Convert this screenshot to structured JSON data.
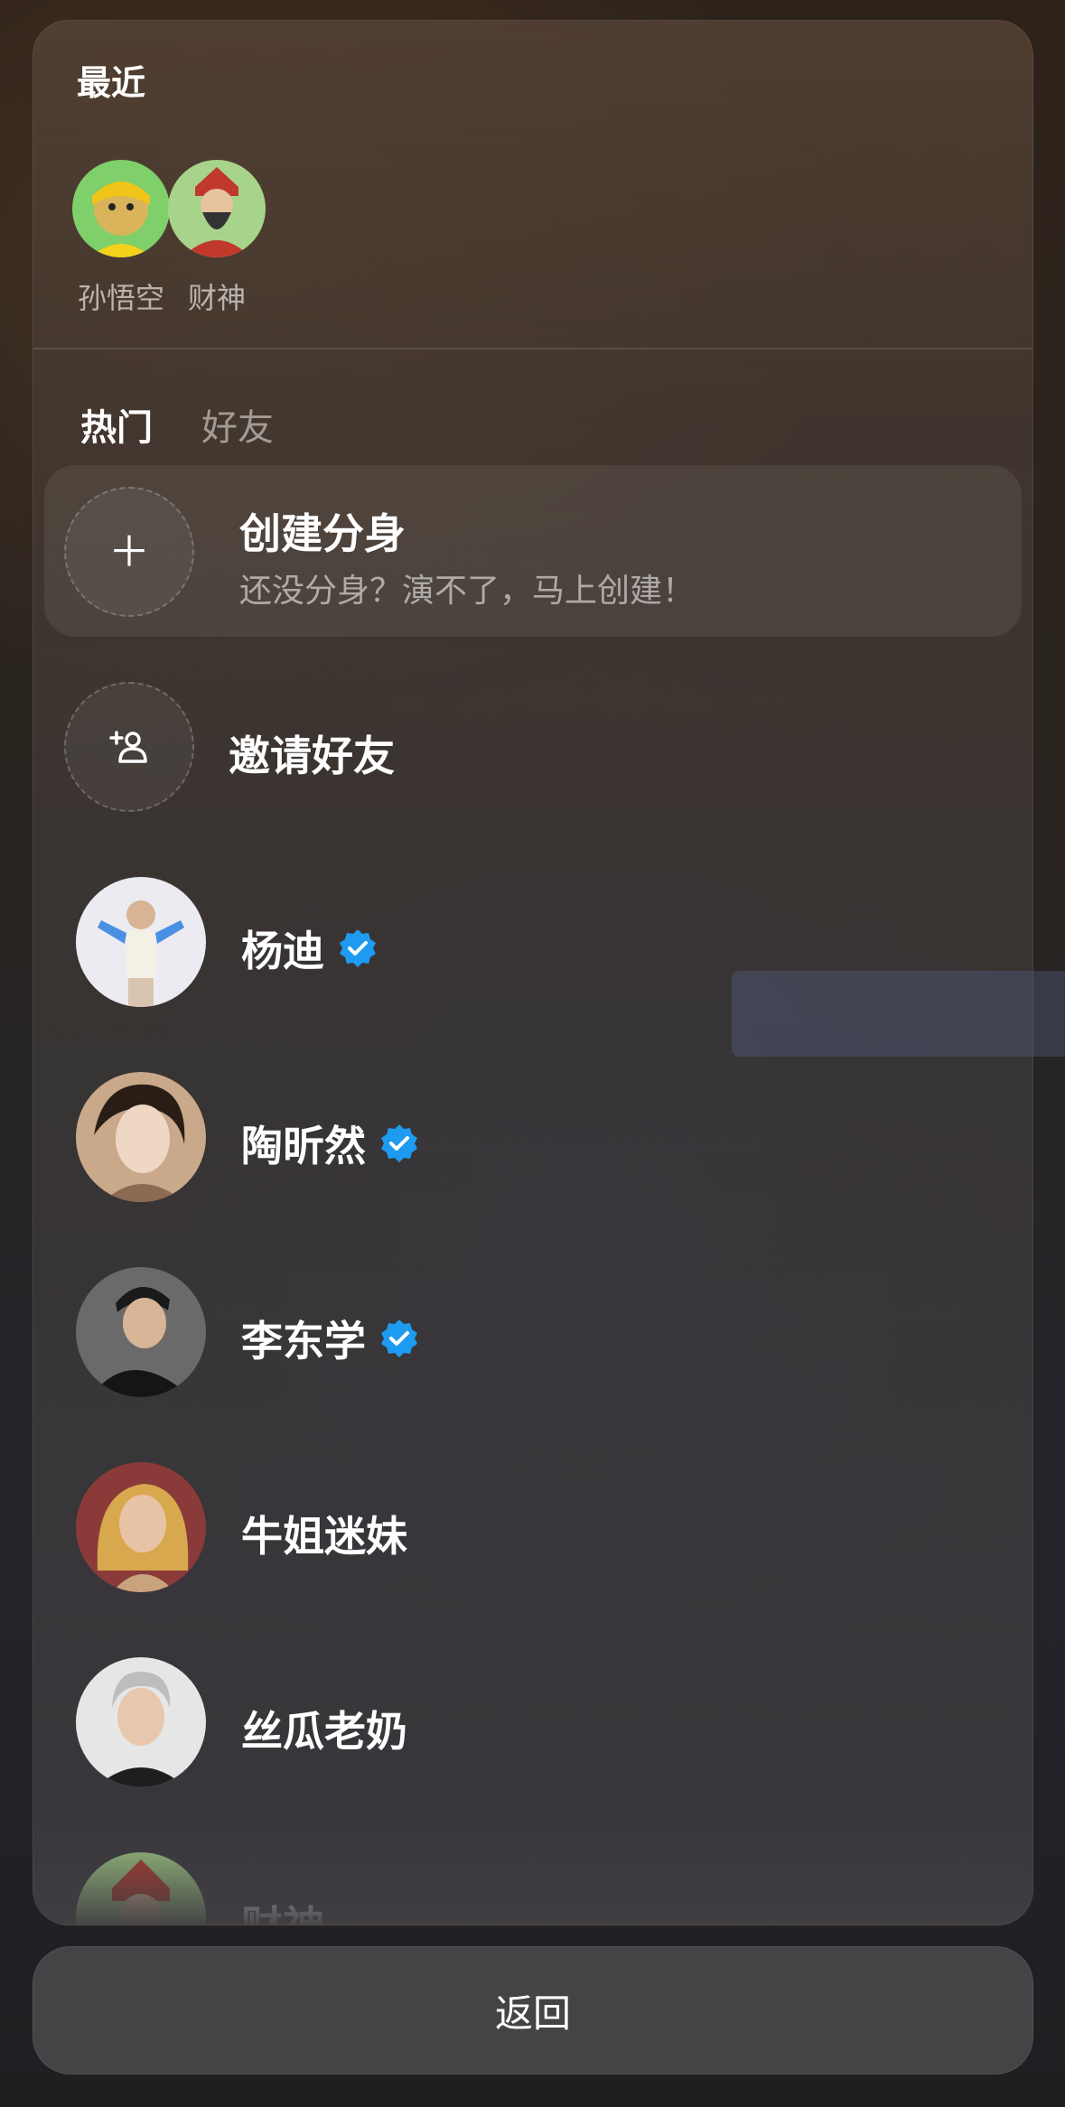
{
  "recent": {
    "title": "最近",
    "items": [
      {
        "name": "孙悟空"
      },
      {
        "name": "财神"
      }
    ]
  },
  "tabs": [
    {
      "label": "热门",
      "active": true
    },
    {
      "label": "好友",
      "active": false
    }
  ],
  "create": {
    "title": "创建分身",
    "subtitle": "还没分身？演不了，马上创建！",
    "icon": "plus-icon"
  },
  "invite": {
    "label": "邀请好友",
    "icon": "add-user-icon"
  },
  "list": [
    {
      "name": "杨迪",
      "verified": true
    },
    {
      "name": "陶昕然",
      "verified": true
    },
    {
      "name": "李东学",
      "verified": true
    },
    {
      "name": "牛姐迷妹",
      "verified": false
    },
    {
      "name": "丝瓜老奶",
      "verified": false
    },
    {
      "name": "财神",
      "verified": false
    }
  ],
  "footer": {
    "back_label": "返回"
  },
  "colors": {
    "verified": "#1d9bf0"
  }
}
